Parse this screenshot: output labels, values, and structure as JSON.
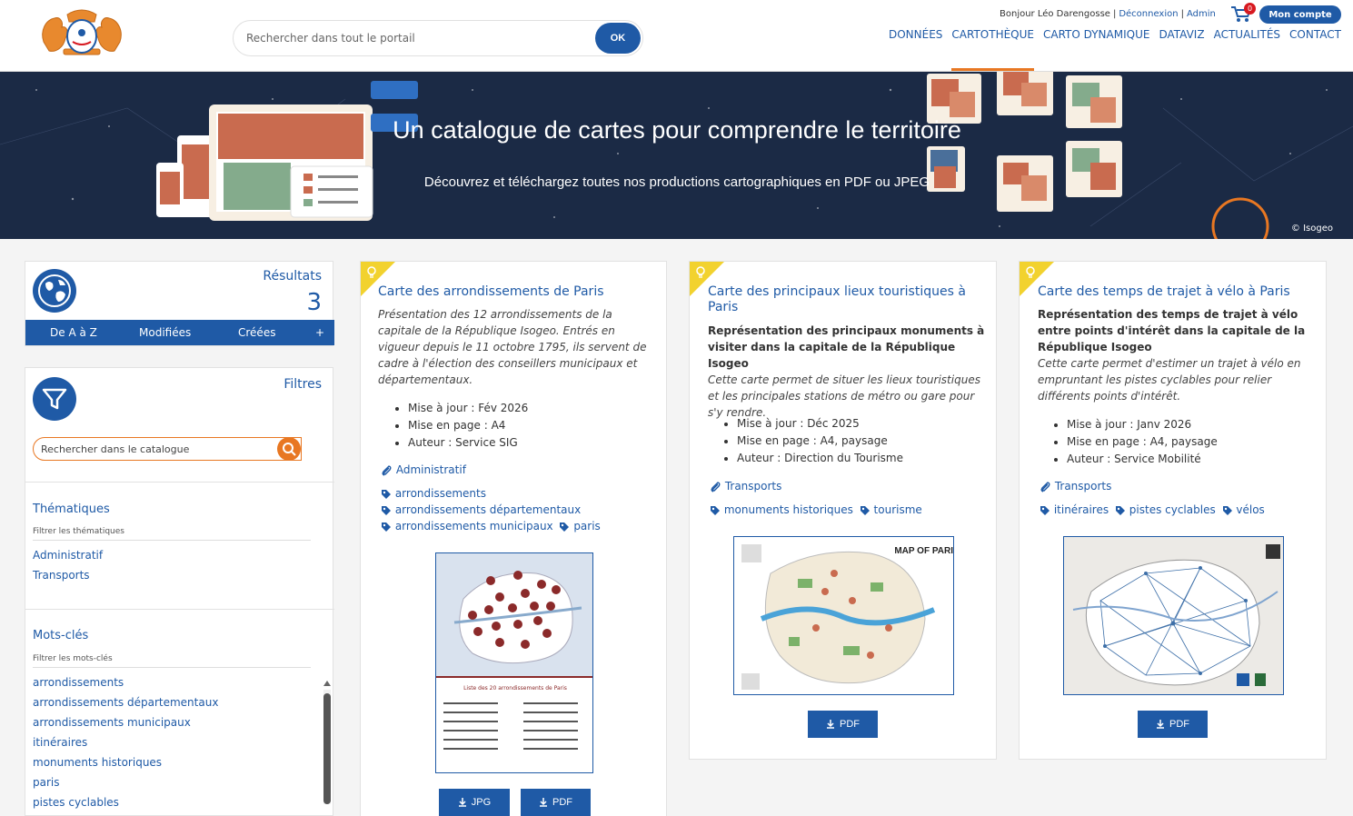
{
  "header": {
    "search_placeholder": "Rechercher dans tout le portail",
    "ok_label": "OK",
    "greeting": "Bonjour Léo Darengosse",
    "separator": "|",
    "logout": "Déconnexion",
    "admin": "Admin",
    "cart_count": "0",
    "account_label": "Mon compte",
    "nav": [
      "DONNÉES",
      "CARTOTHÈQUE",
      "CARTO DYNAMIQUE",
      "DATAVIZ",
      "ACTUALITÉS",
      "CONTACT"
    ],
    "active_nav": "CARTOTHÈQUE"
  },
  "banner": {
    "title": "Un catalogue de cartes pour comprendre le territoire",
    "subtitle": "Découvrez et téléchargez toutes nos productions cartographiques en PDF ou JPEG",
    "credit": "© Isogeo"
  },
  "results": {
    "title": "Résultats",
    "count": "3",
    "sort_options": [
      "De A à Z",
      "Modifiées",
      "Créées",
      "+"
    ]
  },
  "filters": {
    "title": "Filtres",
    "search_placeholder": "Rechercher dans le catalogue",
    "themes": {
      "title": "Thématiques",
      "hint": "Filtrer les thématiques",
      "items": [
        "Administratif",
        "Transports"
      ]
    },
    "keywords": {
      "title": "Mots-clés",
      "hint": "Filtrer les mots-clés",
      "items": [
        "arrondissements",
        "arrondissements départementaux",
        "arrondissements municipaux",
        "itinéraires",
        "monuments historiques",
        "paris",
        "pistes cyclables"
      ]
    }
  },
  "cards": [
    {
      "title": "Carte des arrondissements de Paris",
      "abstract": "",
      "description": "Présentation des 12 arrondissements de la capitale de la République Isogeo. Entrés en vigueur depuis le 11 octobre 1795, ils servent de cadre à l'élection des conseillers municipaux et départementaux.",
      "meta": [
        "Mise à jour : Fév 2026",
        "Mise en page : A4",
        "Auteur : Service SIG"
      ],
      "themes": [
        "Administratif"
      ],
      "tags": [
        "arrondissements",
        "arrondissements départementaux",
        "arrondissements municipaux",
        "paris"
      ],
      "thumb_caption": "Liste des 20 arrondissements de Paris",
      "buttons": [
        "JPG",
        "PDF"
      ]
    },
    {
      "title": "Carte des principaux lieux touristiques à Paris",
      "abstract": "Représentation des principaux monuments à visiter dans la capitale de la République Isogeo",
      "description": "Cette carte permet de situer les lieux touristiques et les principales stations de métro ou gare pour s'y rendre.",
      "meta": [
        "Mise à jour : Déc 2025",
        "Mise en page : A4, paysage",
        "Auteur : Direction du Tourisme"
      ],
      "themes": [
        "Transports"
      ],
      "tags": [
        "monuments historiques",
        "tourisme"
      ],
      "thumb_title": "MAP OF PARIS",
      "buttons": [
        "PDF"
      ]
    },
    {
      "title": "Carte des temps de trajet à vélo à Paris",
      "abstract": "Représentation des temps de trajet à vélo entre points d'intérêt dans la capitale de la République Isogeo",
      "description": "Cette carte permet d'estimer un trajet à vélo en empruntant les pistes cyclables pour relier différents points d'intérêt.",
      "meta": [
        "Mise à jour : Janv 2026",
        "Mise en page : A4, paysage",
        "Auteur : Service Mobilité"
      ],
      "themes": [
        "Transports"
      ],
      "tags": [
        "itinéraires",
        "pistes cyclables",
        "vélos"
      ],
      "buttons": [
        "PDF"
      ]
    }
  ],
  "colors": {
    "primary": "#1f5aa6",
    "accent": "#e87722",
    "banner_bg": "#1b2a45",
    "corner": "#f2d22e"
  }
}
